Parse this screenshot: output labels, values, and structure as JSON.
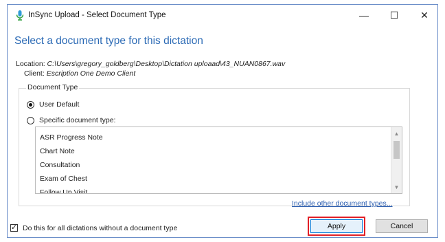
{
  "window": {
    "title": "InSync Upload - Select Document Type",
    "icon": "microphone-icon",
    "controls": {
      "minimize": "—",
      "maximize": "☐",
      "close": "✕"
    }
  },
  "dialog": {
    "heading": "Select a document type for this dictation",
    "location_label": "Location:",
    "location_value": "C:\\Users\\gregory_goldberg\\Desktop\\Dictation uploaad\\43_NUAN0867.wav",
    "client_label": "Client:",
    "client_value": "Escription One Demo Client"
  },
  "document_type": {
    "legend": "Document Type",
    "user_default_label": "User Default",
    "user_default_selected": true,
    "specific_label": "Specific document type:",
    "specific_selected": false,
    "list_items": [
      "ASR Progress Note",
      "Chart Note",
      "Consultation",
      "Exam of Chest",
      "Follow Up Visit"
    ],
    "include_link": "Include other document types..."
  },
  "footer": {
    "checkbox_label": "Do this for all dictations without a document type",
    "checkbox_checked": true,
    "apply_label": "Apply",
    "cancel_label": "Cancel"
  },
  "colors": {
    "heading": "#2b6ab5",
    "link": "#2a5db0",
    "highlight": "#e21f26",
    "window_border": "#6b8ec9"
  }
}
